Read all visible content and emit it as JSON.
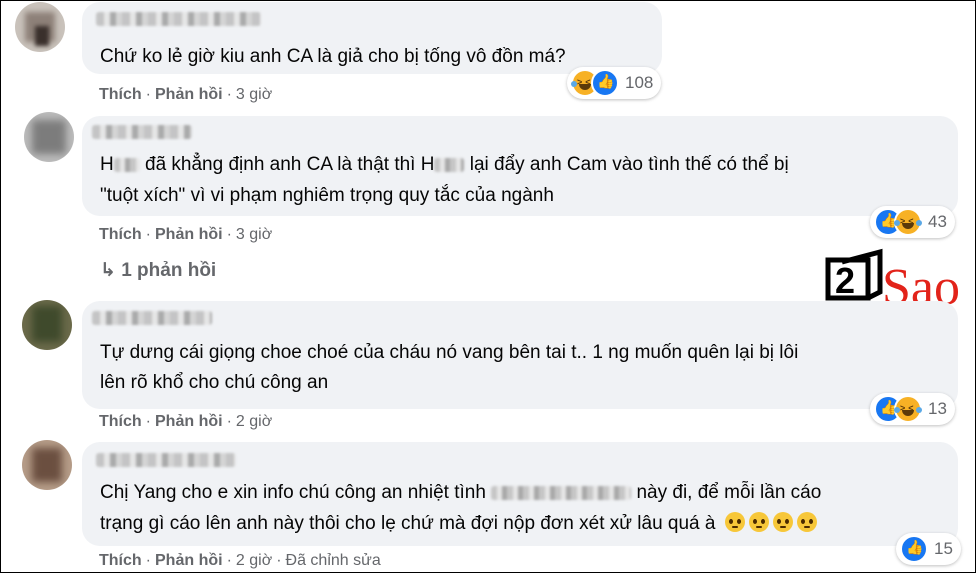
{
  "comments": [
    {
      "text_lines": [
        "Chứ ko lẻ giờ kiu anh CA là giả cho bị tống vô đồn má?"
      ],
      "actions": {
        "like": "Thích",
        "reply": "Phản hồi",
        "time": "3 giờ"
      },
      "reactions": {
        "icons": [
          "haha-icon",
          "like-icon"
        ],
        "count": "108"
      }
    },
    {
      "text_segments": [
        {
          "before": "H",
          "after": " đã khẳng định anh CA là thật thì H",
          "after2": " lại đẩy anh Cam vào tình thế có thể bị"
        },
        {
          "line2": "\"tuột xích\" vì vi phạm nghiêm trọng quy tắc của ngành"
        }
      ],
      "actions": {
        "like": "Thích",
        "reply": "Phản hồi",
        "time": "3 giờ"
      },
      "reactions": {
        "icons": [
          "like-icon",
          "haha-icon"
        ],
        "count": "43"
      },
      "replies_label": "1 phản hồi"
    },
    {
      "text_lines": [
        "Tự dưng cái giọng choe choé của cháu nó vang bên tai t.. 1 ng muốn quên lại bị lôi",
        "lên rõ khổ cho chú công an"
      ],
      "actions": {
        "like": "Thích",
        "reply": "Phản hồi",
        "time": "2 giờ"
      },
      "reactions": {
        "icons": [
          "like-icon",
          "haha-icon"
        ],
        "count": "13"
      }
    },
    {
      "line1_before": "Chị Yang cho e xin info chú công an nhiệt tình ",
      "line1_after": " này đi, để mỗi lần cáo",
      "line2": "trạng gì cáo lên anh này thôi cho lẹ chứ mà đợi nộp đơn xét xử lâu quá à",
      "line2_emoji": [
        "pleading-face-icon",
        "pleading-face-icon",
        "pleading-face-icon",
        "pleading-face-icon"
      ],
      "actions": {
        "like": "Thích",
        "reply": "Phản hồi",
        "time": "2 giờ",
        "edited": "Đã chỉnh sửa"
      },
      "reactions": {
        "icons": [
          "like-icon"
        ],
        "count": "15"
      }
    }
  ],
  "watermark": {
    "digit": "2",
    "text": "Sao"
  },
  "colors": {
    "bubble": "#f0f2f5",
    "meta": "#65676b",
    "like": "#1877f2",
    "haha": "#f7b125",
    "logo_red": "#e2231a"
  }
}
